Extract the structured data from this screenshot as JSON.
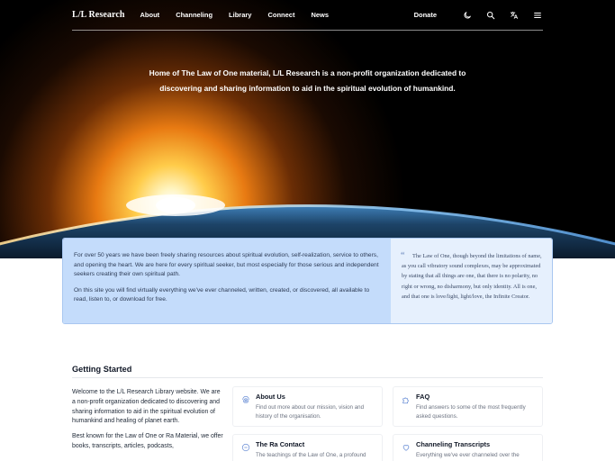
{
  "nav": {
    "logo": "L/L Research",
    "links": [
      "About",
      "Channeling",
      "Library",
      "Connect",
      "News"
    ],
    "donate": "Donate",
    "icons": [
      "moon-icon",
      "search-icon",
      "translate-icon",
      "menu-icon"
    ]
  },
  "hero": {
    "text": "Home of The Law of One material, L/L Research is a non-profit organization dedicated to discovering and sharing information to aid in the spiritual evolution of humankind."
  },
  "panel": {
    "para1": "For over 50 years we have been freely sharing resources about spiritual evolution, self-realization, service to others, and opening the heart. We are here for every spiritual seeker, but most especially for those serious and independent seekers creating their own spiritual path.",
    "para2": "On this site you will find virtually everything we've ever channeled, written, created, or discovered, all available to read, listen to, or download for free.",
    "quote": "The Law of One, though beyond the limitations of name, as you call vibratory sound complexes, may be approximated by stating that all things are one, that there is no polarity, no right or wrong, no disharmony, but only identity. All is one, and that one is love/light, light/love, the Infinite Creator."
  },
  "getting_started": {
    "title": "Getting Started",
    "intro1": "Welcome to the L/L Research Library website. We are a non-profit organization dedicated to discovering and sharing information to aid in the spiritual evolution of humankind and healing of planet earth.",
    "intro2": "Best known for the Law of One or Ra Material, we offer books, transcripts, articles, podcasts,",
    "cards": [
      {
        "title": "About Us",
        "desc": "Find out more about our mission, vision and history of the organisation.",
        "icon": "fingerprint-icon"
      },
      {
        "title": "FAQ",
        "desc": "Find answers to some of the most frequently asked questions.",
        "icon": "puzzle-icon"
      },
      {
        "title": "The Ra Contact",
        "desc": "The teachings of the Law of One, a profound",
        "icon": "circle-icon"
      },
      {
        "title": "Channeling Transcripts",
        "desc": "Everything we've ever channeled over the",
        "icon": "heart-icon"
      }
    ]
  },
  "colors": {
    "panel_left": "#c4dcfb",
    "panel_right": "#e6f0fd",
    "accent": "#5b7bb5"
  }
}
